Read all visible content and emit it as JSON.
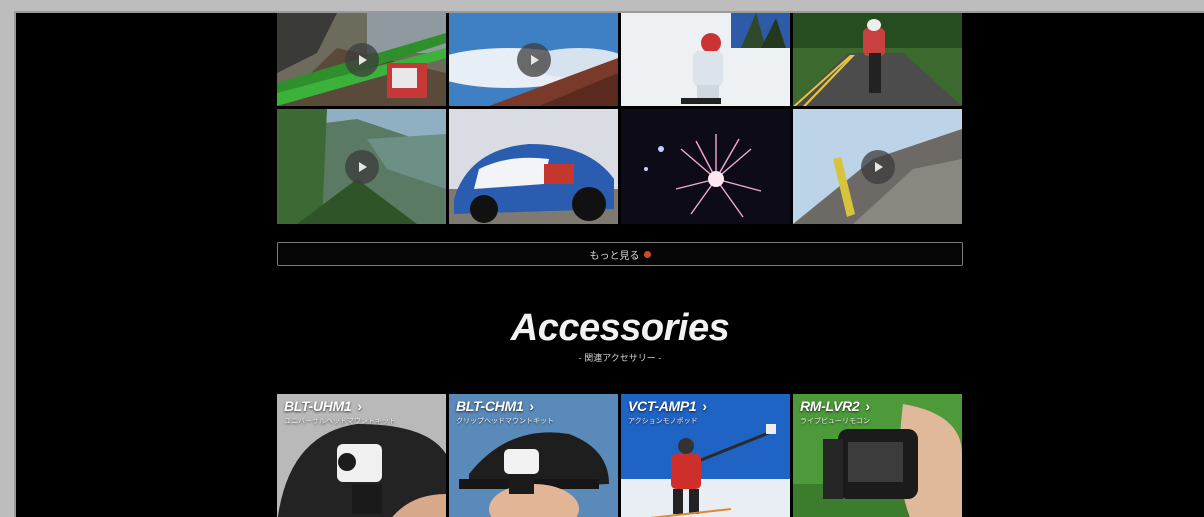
{
  "videos": [
    {
      "label": "mountain-bike-handlebar"
    },
    {
      "label": "above-clouds-mountain"
    },
    {
      "label": "snowboarder"
    },
    {
      "label": "road-cyclist"
    },
    {
      "label": "cliff-valley"
    },
    {
      "label": "rally-car"
    },
    {
      "label": "fireworks"
    },
    {
      "label": "rock-ridge"
    }
  ],
  "more_button": {
    "label": "もっと見る"
  },
  "accessories_section": {
    "title": "Accessories",
    "subtitle": "- 関連アクセサリー -",
    "items": [
      {
        "model": "BLT-UHM1",
        "name": "ユニバーサルヘッドマウントキット"
      },
      {
        "model": "BLT-CHM1",
        "name": "クリップヘッドマウントキット"
      },
      {
        "model": "VCT-AMP1",
        "name": "アクションモノポッド"
      },
      {
        "model": "RM-LVR2",
        "name": "ライブビューリモコン"
      }
    ],
    "chevron": "›"
  },
  "colors": {
    "background": "#000000",
    "accent_arrow": "#d4471f",
    "button_border": "#7a7a7a"
  }
}
